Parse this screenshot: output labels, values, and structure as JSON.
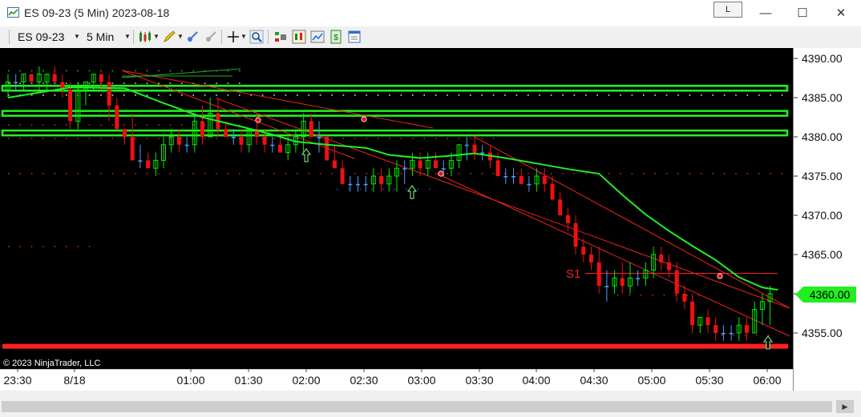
{
  "window": {
    "title": "ES 09-23 (5 Min)  2023-08-18",
    "l_button": "L",
    "minimize_glyph": "—",
    "maximize_glyph": "☐",
    "close_glyph": "✕"
  },
  "toolbar": {
    "instrument": "ES 09-23",
    "interval": "5 Min",
    "icons": [
      "candlestick-style-icon",
      "pencil-draw-icon",
      "attach-indicator-icon",
      "detach-icon",
      "crosshair-icon",
      "zoom-icon",
      "strategy-icon",
      "data-series-icon",
      "chart-trader-icon",
      "price-icon",
      "properties-icon"
    ]
  },
  "chart": {
    "copyright": "© 2023 NinjaTrader, LLC",
    "current_price": "4360.00",
    "s1_label": "S1",
    "colors": {
      "up": "#00ee00",
      "down": "#ee1111",
      "doji": "#4aa0ff",
      "ma": "#22ee22",
      "level": "#22ee22",
      "support": "#ff2020"
    }
  },
  "chart_data": {
    "type": "candlestick",
    "instrument": "ES 09-23",
    "interval": "5 Min",
    "date": "2023-08-18",
    "y_ticks": [
      "4390.00",
      "4385.00",
      "4380.00",
      "4375.00",
      "4370.00",
      "4365.00",
      "4360.00",
      "4355.00"
    ],
    "ylim": [
      4351.5,
      4391.5
    ],
    "x_ticks": [
      "23:30",
      "8/18",
      "01:00",
      "01:30",
      "02:00",
      "02:30",
      "03:00",
      "03:30",
      "04:00",
      "04:30",
      "05:00",
      "05:30",
      "06:00"
    ],
    "horizontal_levels": [
      4386.2,
      4383.0,
      4380.5
    ],
    "support_level": 4353.3,
    "s1_level": 4362.6,
    "last_price": 4360.0,
    "candles": [
      [
        4386,
        4388,
        4385,
        4387
      ],
      [
        4387,
        4388,
        4386,
        4387
      ],
      [
        4387,
        4388,
        4386,
        4388
      ],
      [
        4388,
        4388,
        4387,
        4387
      ],
      [
        4387,
        4389,
        4386,
        4388
      ],
      [
        4387,
        4388,
        4386,
        4388
      ],
      [
        4388,
        4389,
        4387,
        4387
      ],
      [
        4387,
        4388,
        4385,
        4386
      ],
      [
        4386,
        4387,
        4381,
        4382
      ],
      [
        4382,
        4387,
        4381,
        4386
      ],
      [
        4386,
        4387,
        4384,
        4387
      ],
      [
        4387,
        4388,
        4386,
        4388
      ],
      [
        4388,
        4388,
        4386,
        4387
      ],
      [
        4387,
        4388,
        4382,
        4384
      ],
      [
        4384,
        4385,
        4381,
        4381
      ],
      [
        4381,
        4381,
        4379,
        4380
      ],
      [
        4380,
        4383,
        4377,
        4377
      ],
      [
        4377,
        4379,
        4376,
        4377
      ],
      [
        4377,
        4378,
        4376,
        4376
      ],
      [
        4376,
        4378,
        4375,
        4377
      ],
      [
        4377,
        4380,
        4376,
        4379
      ],
      [
        4379,
        4381,
        4378,
        4380
      ],
      [
        4380,
        4381,
        4378,
        4379
      ],
      [
        4379,
        4380,
        4378,
        4379
      ],
      [
        4379,
        4383,
        4378,
        4382
      ],
      [
        4382,
        4384,
        4379,
        4380
      ],
      [
        4380,
        4385,
        4380,
        4383
      ],
      [
        4383,
        4385,
        4380,
        4381
      ],
      [
        4381,
        4382,
        4380,
        4380
      ],
      [
        4380,
        4381,
        4379,
        4380
      ],
      [
        4380,
        4381,
        4378,
        4379
      ],
      [
        4379,
        4381,
        4378,
        4381
      ],
      [
        4381,
        4383,
        4379,
        4380
      ],
      [
        4380,
        4381,
        4378,
        4379
      ],
      [
        4379,
        4380,
        4378,
        4379
      ],
      [
        4379,
        4380,
        4378,
        4378
      ],
      [
        4378,
        4380,
        4377,
        4379
      ],
      [
        4379,
        4381,
        4378,
        4380
      ],
      [
        4380,
        4383,
        4378,
        4382
      ],
      [
        4382,
        4383,
        4380,
        4380
      ],
      [
        4380,
        4382,
        4378,
        4380
      ],
      [
        4380,
        4380,
        4377,
        4377
      ],
      [
        4377,
        4379,
        4376,
        4376
      ],
      [
        4376,
        4377,
        4374,
        4374
      ],
      [
        4374,
        4375,
        4373,
        4374
      ],
      [
        4374,
        4375,
        4373,
        4374
      ],
      [
        4374,
        4375,
        4373,
        4374
      ],
      [
        4374,
        4376,
        4373,
        4375
      ],
      [
        4375,
        4376,
        4373,
        4374
      ],
      [
        4374,
        4376,
        4373,
        4375
      ],
      [
        4375,
        4377,
        4373,
        4376
      ],
      [
        4376,
        4377,
        4374,
        4376
      ],
      [
        4376,
        4378,
        4375,
        4377
      ],
      [
        4377,
        4378,
        4375,
        4376
      ],
      [
        4376,
        4378,
        4375,
        4377
      ],
      [
        4377,
        4378,
        4376,
        4376
      ],
      [
        4376,
        4377,
        4375,
        4376
      ],
      [
        4376,
        4378,
        4375,
        4377
      ],
      [
        4377,
        4379,
        4376,
        4379
      ],
      [
        4379,
        4380,
        4377,
        4379
      ],
      [
        4379,
        4380,
        4377,
        4378
      ],
      [
        4378,
        4379,
        4377,
        4378
      ],
      [
        4378,
        4379,
        4376,
        4377
      ],
      [
        4377,
        4378,
        4375,
        4375
      ],
      [
        4375,
        4376,
        4374,
        4375
      ],
      [
        4375,
        4376,
        4374,
        4375
      ],
      [
        4375,
        4376,
        4374,
        4374
      ],
      [
        4374,
        4375,
        4373,
        4374
      ],
      [
        4374,
        4376,
        4373,
        4375
      ],
      [
        4375,
        4376,
        4373,
        4374
      ],
      [
        4374,
        4375,
        4372,
        4372
      ],
      [
        4372,
        4373,
        4370,
        4370
      ],
      [
        4370,
        4371,
        4368,
        4369
      ],
      [
        4369,
        4370,
        4365,
        4366
      ],
      [
        4366,
        4367,
        4364,
        4365
      ],
      [
        4365,
        4366,
        4363,
        4364
      ],
      [
        4364,
        4366,
        4360,
        4361
      ],
      [
        4361,
        4363,
        4359,
        4361
      ],
      [
        4361,
        4363,
        4360,
        4362
      ],
      [
        4362,
        4364,
        4360,
        4361
      ],
      [
        4361,
        4364,
        4360,
        4362
      ],
      [
        4362,
        4363,
        4361,
        4362
      ],
      [
        4362,
        4364,
        4361,
        4363
      ],
      [
        4363,
        4366,
        4362,
        4365
      ],
      [
        4365,
        4366,
        4363,
        4364
      ],
      [
        4364,
        4365,
        4362,
        4363
      ],
      [
        4363,
        4364,
        4359,
        4360
      ],
      [
        4360,
        4361,
        4358,
        4359
      ],
      [
        4359,
        4360,
        4355,
        4356
      ],
      [
        4356,
        4357,
        4355,
        4357
      ],
      [
        4357,
        4358,
        4355,
        4356
      ],
      [
        4356,
        4357,
        4354,
        4355
      ],
      [
        4355,
        4356,
        4354,
        4355
      ],
      [
        4355,
        4356,
        4354,
        4355
      ],
      [
        4355,
        4357,
        4354,
        4356
      ],
      [
        4356,
        4357,
        4354,
        4355
      ],
      [
        4355,
        4359,
        4355,
        4358
      ],
      [
        4358,
        4360,
        4356,
        4359
      ],
      [
        4359,
        4361,
        4356,
        4360
      ]
    ],
    "ma_points": [
      [
        0,
        4385.0
      ],
      [
        8,
        4386.3
      ],
      [
        15,
        4386.2
      ],
      [
        20,
        4384.3
      ],
      [
        25,
        4382.5
      ],
      [
        30,
        4381.3
      ],
      [
        34,
        4380.3
      ],
      [
        37,
        4379.4
      ],
      [
        41,
        4379.0
      ],
      [
        46,
        4378.6
      ],
      [
        49,
        4377.7
      ],
      [
        53,
        4377.3
      ],
      [
        57,
        4377.6
      ],
      [
        60,
        4377.9
      ],
      [
        64,
        4377.3
      ],
      [
        68,
        4376.6
      ],
      [
        72,
        4375.9
      ],
      [
        76,
        4375.3
      ],
      [
        79,
        4372.6
      ],
      [
        82,
        4370.1
      ],
      [
        85,
        4368.0
      ],
      [
        88,
        4366.1
      ],
      [
        91,
        4364.3
      ],
      [
        94,
        4362.1
      ],
      [
        97,
        4360.8
      ],
      [
        99,
        4360.5
      ]
    ]
  }
}
